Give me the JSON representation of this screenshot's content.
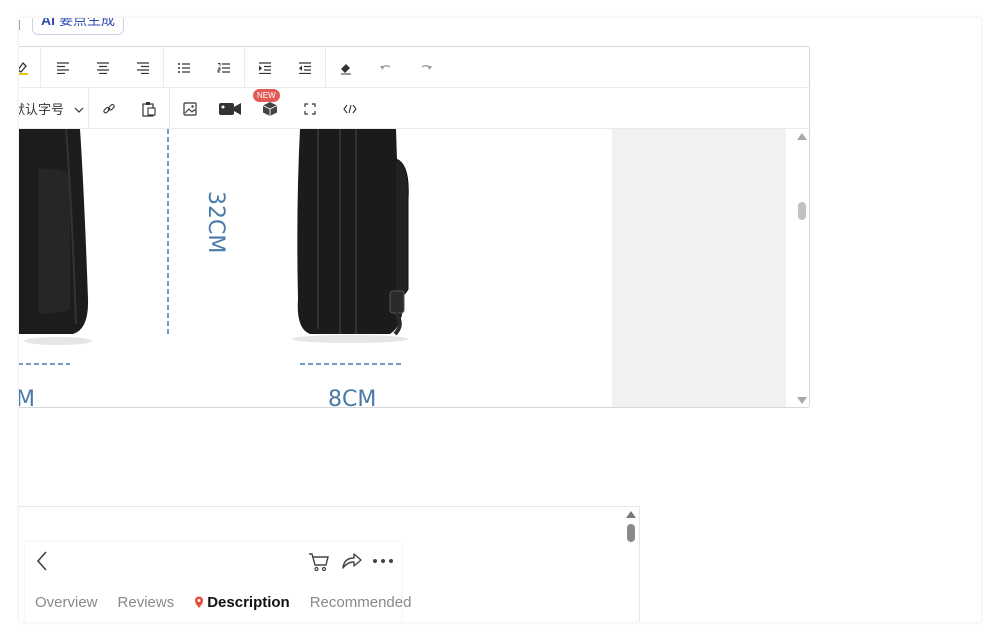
{
  "header": {
    "ai_badge": "AI",
    "ai_label": "要点生成"
  },
  "editor": {
    "font_size_label": "默认字号",
    "new_badge": "NEW",
    "dimensions": {
      "height_label": "32CM",
      "depth_label": "8CM",
      "width_label_partial": "M"
    }
  },
  "preview": {
    "tabs": [
      {
        "label": "Overview"
      },
      {
        "label": "Reviews"
      },
      {
        "label": "Description"
      },
      {
        "label": "Recommended"
      }
    ]
  },
  "colors": {
    "accent": "#2f4bb0",
    "badge": "#e25a55",
    "dimension": "#4a7aa8",
    "pin": "#e74c3c"
  }
}
